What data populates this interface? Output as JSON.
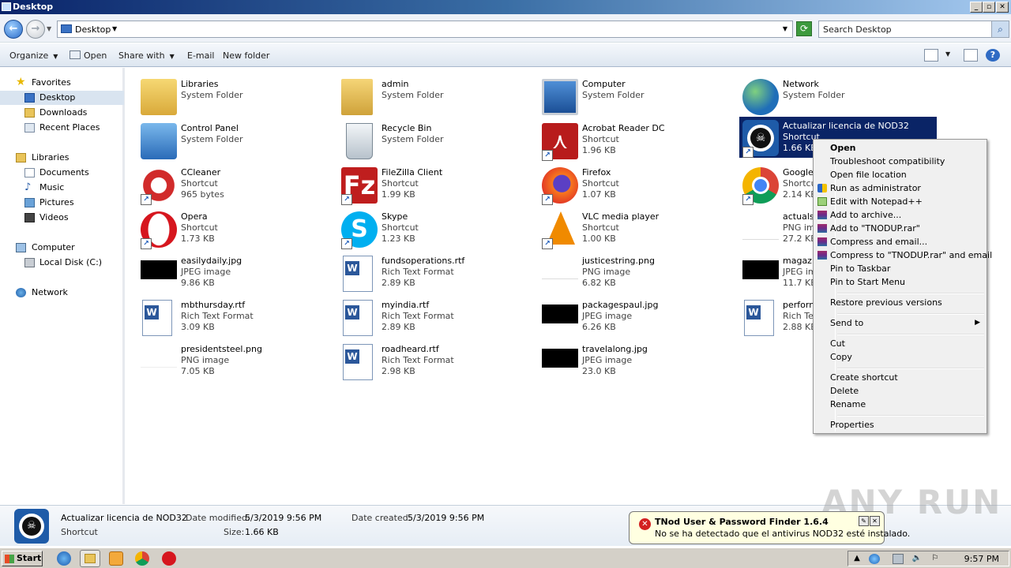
{
  "window": {
    "title": "Desktop"
  },
  "address": {
    "path": "Desktop",
    "search_placeholder": "Search Desktop"
  },
  "toolbar": {
    "organize": "Organize",
    "open": "Open",
    "share_with": "Share with",
    "email": "E-mail",
    "new_folder": "New folder"
  },
  "sidebar": {
    "favorites": "Favorites",
    "desktop": "Desktop",
    "downloads": "Downloads",
    "recent_places": "Recent Places",
    "libraries": "Libraries",
    "documents": "Documents",
    "music": "Music",
    "pictures": "Pictures",
    "videos": "Videos",
    "computer": "Computer",
    "local_disk": "Local Disk (C:)",
    "network": "Network"
  },
  "items": [
    {
      "name": "Libraries",
      "type": "System Folder",
      "size": "",
      "icon": "libraries-icon"
    },
    {
      "name": "admin",
      "type": "System Folder",
      "size": "",
      "icon": "user-folder-icon"
    },
    {
      "name": "Computer",
      "type": "System Folder",
      "size": "",
      "icon": "computer-icon"
    },
    {
      "name": "Network",
      "type": "System Folder",
      "size": "",
      "icon": "network-icon"
    },
    {
      "name": "Control Panel",
      "type": "System Folder",
      "size": "",
      "icon": "control-panel-icon"
    },
    {
      "name": "Recycle Bin",
      "type": "System Folder",
      "size": "",
      "icon": "recycle-bin-icon"
    },
    {
      "name": "Acrobat Reader DC",
      "type": "Shortcut",
      "size": "1.96 KB",
      "icon": "acrobat-icon"
    },
    {
      "name": "Actualizar licencia de NOD32",
      "type": "Shortcut",
      "size": "1.66 KB",
      "icon": "nod32-icon"
    },
    {
      "name": "CCleaner",
      "type": "Shortcut",
      "size": "965 bytes",
      "icon": "ccleaner-icon"
    },
    {
      "name": "FileZilla Client",
      "type": "Shortcut",
      "size": "1.99 KB",
      "icon": "filezilla-icon"
    },
    {
      "name": "Firefox",
      "type": "Shortcut",
      "size": "1.07 KB",
      "icon": "firefox-icon"
    },
    {
      "name": "Google",
      "type": "Shortcut",
      "size": "2.14 KB",
      "icon": "chrome-icon"
    },
    {
      "name": "Opera",
      "type": "Shortcut",
      "size": "1.73 KB",
      "icon": "opera-icon"
    },
    {
      "name": "Skype",
      "type": "Shortcut",
      "size": "1.23 KB",
      "icon": "skype-icon"
    },
    {
      "name": "VLC media player",
      "type": "Shortcut",
      "size": "1.00 KB",
      "icon": "vlc-icon"
    },
    {
      "name": "actualsh",
      "type": "PNG ima",
      "size": "27.2 KB",
      "icon": "png-icon"
    },
    {
      "name": "easilydaily.jpg",
      "type": "JPEG image",
      "size": "9.86 KB",
      "icon": "jpeg-icon"
    },
    {
      "name": "fundsoperations.rtf",
      "type": "Rich Text Format",
      "size": "2.89 KB",
      "icon": "rtf-icon"
    },
    {
      "name": "justicestring.png",
      "type": "PNG image",
      "size": "6.82 KB",
      "icon": "png-icon"
    },
    {
      "name": "magazir",
      "type": "JPEG im",
      "size": "11.7 KB",
      "icon": "jpeg-icon"
    },
    {
      "name": "mbthursday.rtf",
      "type": "Rich Text Format",
      "size": "3.09 KB",
      "icon": "rtf-icon"
    },
    {
      "name": "myindia.rtf",
      "type": "Rich Text Format",
      "size": "2.89 KB",
      "icon": "rtf-icon"
    },
    {
      "name": "packagespaul.jpg",
      "type": "JPEG image",
      "size": "6.26 KB",
      "icon": "jpeg-icon"
    },
    {
      "name": "perform",
      "type": "Rich Tex",
      "size": "2.88 KB",
      "icon": "rtf-icon"
    },
    {
      "name": "presidentsteel.png",
      "type": "PNG image",
      "size": "7.05 KB",
      "icon": "png-icon"
    },
    {
      "name": "roadheard.rtf",
      "type": "Rich Text Format",
      "size": "2.98 KB",
      "icon": "rtf-icon"
    },
    {
      "name": "travelalong.jpg",
      "type": "JPEG image",
      "size": "23.0 KB",
      "icon": "jpeg-icon"
    }
  ],
  "context_menu": [
    "Open",
    "Troubleshoot compatibility",
    "Open file location",
    "Run as administrator",
    "Edit with Notepad++",
    "Add to archive...",
    "Add to \"TNODUP.rar\"",
    "Compress and email...",
    "Compress to \"TNODUP.rar\" and email",
    "Pin to Taskbar",
    "Pin to Start Menu",
    "Restore previous versions",
    "Send to",
    "Cut",
    "Copy",
    "Create shortcut",
    "Delete",
    "Rename",
    "Properties"
  ],
  "details": {
    "name": "Actualizar licencia de NOD32",
    "type": "Shortcut",
    "date_modified_label": "Date modified:",
    "date_modified": "5/3/2019 9:56 PM",
    "size_label": "Size:",
    "size": "1.66 KB",
    "date_created_label": "Date created:",
    "date_created": "5/3/2019 9:56 PM"
  },
  "balloon": {
    "title": "TNod User & Password Finder 1.6.4",
    "message": "No se ha detectado que el antivirus NOD32 esté instalado."
  },
  "taskbar": {
    "start": "Start",
    "clock": "9:57 PM"
  },
  "watermark": "ANY RUN",
  "colors": {
    "selection": "#0a2466",
    "title_bar": "#0a246a",
    "balloon_bg": "#ffffe1"
  }
}
